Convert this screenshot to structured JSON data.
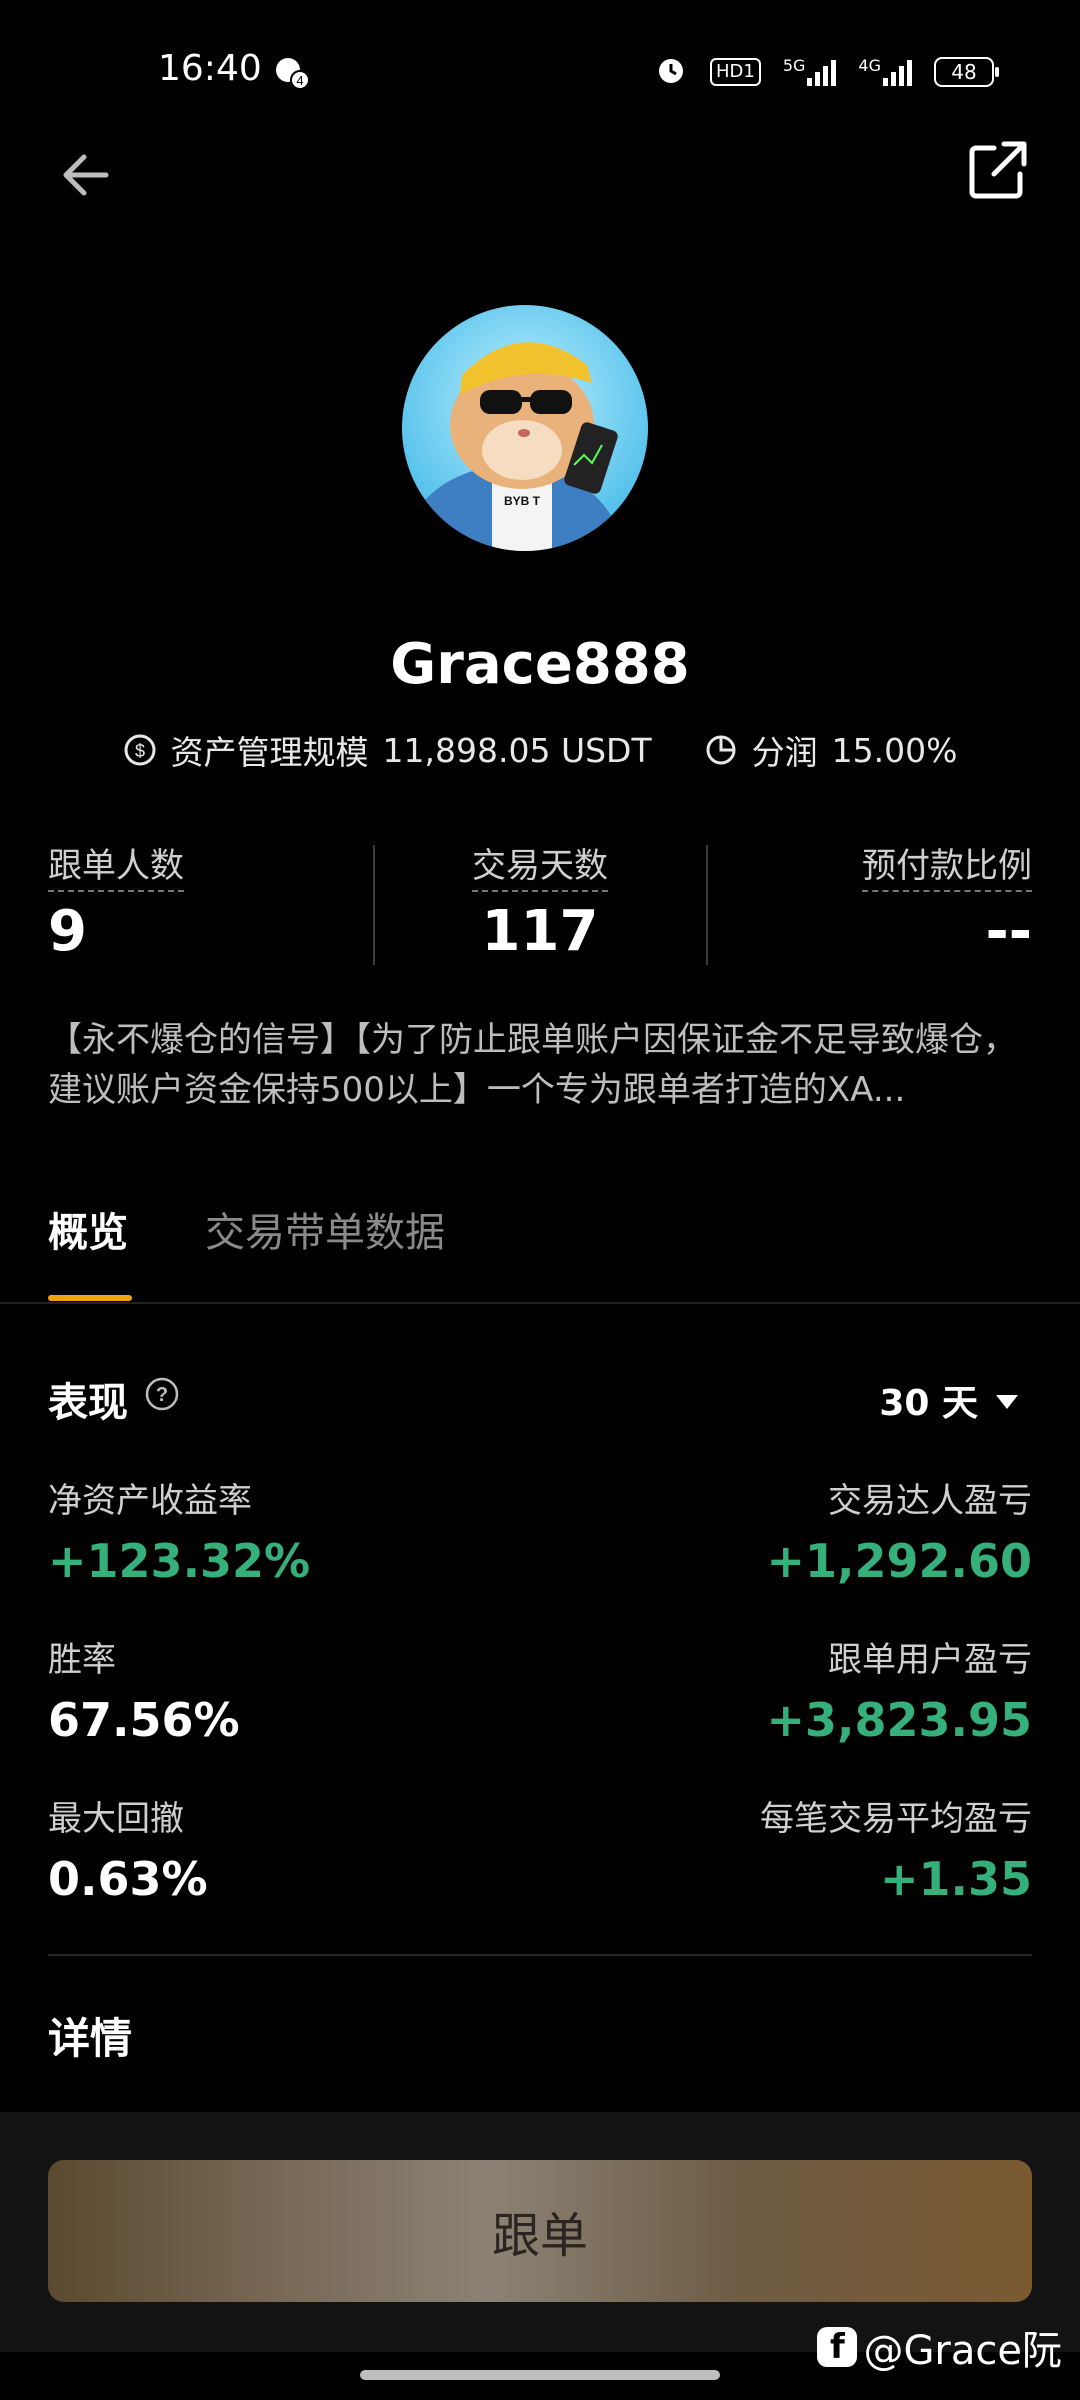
{
  "status_bar": {
    "time": "16:40",
    "notif_count": "4",
    "hd_label": "HD1",
    "net_5g": "5G",
    "net_4g": "4G",
    "battery": "48"
  },
  "profile": {
    "name": "Grace888",
    "aum_label": "资产管理规模",
    "aum_value": "11,898.05 USDT",
    "profit_share_label": "分润",
    "profit_share_value": "15.00%",
    "avatar_shirt_text": "BYB T"
  },
  "stats": [
    {
      "label": "跟单人数",
      "value": "9"
    },
    {
      "label": "交易天数",
      "value": "117"
    },
    {
      "label": "预付款比例",
      "value": "--"
    }
  ],
  "description": "【永不爆仓的信号】【为了防止跟单账户因保证金不足导致爆仓，建议账户资金保持500以上】一个专为跟单者打造的XA...",
  "tabs": [
    {
      "label": "概览",
      "active": true
    },
    {
      "label": "交易带单数据",
      "active": false
    }
  ],
  "performance": {
    "title": "表现",
    "period": "30 天",
    "metrics": [
      {
        "label": "净资产收益率",
        "value": "+123.32%",
        "positive": true
      },
      {
        "label": "交易达人盈亏",
        "value": "+1,292.60",
        "positive": true
      },
      {
        "label": "胜率",
        "value": "67.56%",
        "positive": false
      },
      {
        "label": "跟单用户盈亏",
        "value": "+3,823.95",
        "positive": true
      },
      {
        "label": "最大回撤",
        "value": "0.63%",
        "positive": false
      },
      {
        "label": "每笔交易平均盈亏",
        "value": "+1.35",
        "positive": true
      }
    ]
  },
  "details_title": "详情",
  "follow_button": "跟单",
  "watermark": "@Grace阮",
  "colors": {
    "accent": "#f0a30a",
    "positive": "#35b07a",
    "background": "#000000"
  }
}
